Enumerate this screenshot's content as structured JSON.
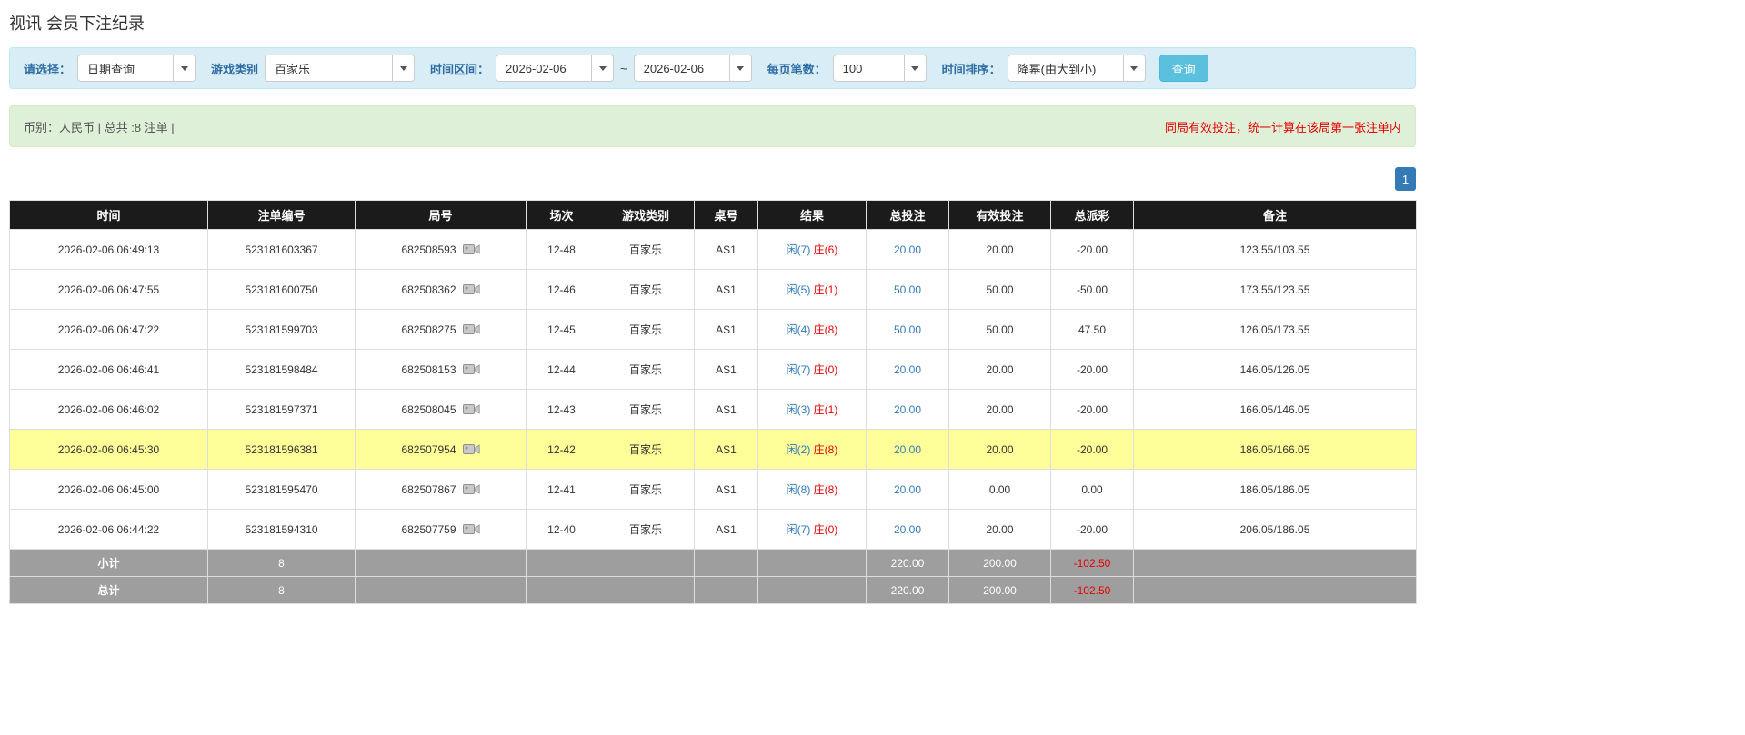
{
  "page_title": "视讯 会员下注纪录",
  "filters": {
    "select_label": "请选择：",
    "select_value": "日期查询",
    "game_type_label": "游戏类别",
    "game_type_value": "百家乐",
    "time_range_label": "时间区间：",
    "date_from": "2026-02-06",
    "tilde": "~",
    "date_to": "2026-02-06",
    "page_size_label": "每页笔数：",
    "page_size_value": "100",
    "sort_label": "时间排序：",
    "sort_value": "降幂(由大到小)",
    "search_button": "查询"
  },
  "summary_bar": {
    "left_text": "币别：人民币 | 总共 :8 注单 |",
    "right_text": "同局有效投注，统一计算在该局第一张注单内"
  },
  "pagination": {
    "current": "1"
  },
  "colors": {
    "accent_blue": "#337ab7",
    "result_player_blue": "#337ab7",
    "result_banker_red": "#e60000",
    "negative_red": "#e60000",
    "highlight_yellow": "#ffff99",
    "header_black": "#1b1b1b",
    "summary_gray": "#9e9e9e"
  },
  "table": {
    "headers": [
      "时间",
      "注单编号",
      "局号",
      "场次",
      "游戏类别",
      "桌号",
      "结果",
      "总投注",
      "有效投注",
      "总派彩",
      "备注"
    ],
    "rows": [
      {
        "time": "2026-02-06 06:49:13",
        "bet_id": "523181603367",
        "round_id": "682508593",
        "session": "12-48",
        "game": "百家乐",
        "table_no": "AS1",
        "result_player": "闲(7)",
        "result_banker": "庄(6)",
        "total_bet": "20.00",
        "valid_bet": "20.00",
        "payout": "-20.00",
        "remark": "123.55/103.55",
        "highlighted": false
      },
      {
        "time": "2026-02-06 06:47:55",
        "bet_id": "523181600750",
        "round_id": "682508362",
        "session": "12-46",
        "game": "百家乐",
        "table_no": "AS1",
        "result_player": "闲(5)",
        "result_banker": "庄(1)",
        "total_bet": "50.00",
        "valid_bet": "50.00",
        "payout": "-50.00",
        "remark": "173.55/123.55",
        "highlighted": false
      },
      {
        "time": "2026-02-06 06:47:22",
        "bet_id": "523181599703",
        "round_id": "682508275",
        "session": "12-45",
        "game": "百家乐",
        "table_no": "AS1",
        "result_player": "闲(4)",
        "result_banker": "庄(8)",
        "total_bet": "50.00",
        "valid_bet": "50.00",
        "payout": "47.50",
        "remark": "126.05/173.55",
        "highlighted": false
      },
      {
        "time": "2026-02-06 06:46:41",
        "bet_id": "523181598484",
        "round_id": "682508153",
        "session": "12-44",
        "game": "百家乐",
        "table_no": "AS1",
        "result_player": "闲(7)",
        "result_banker": "庄(0)",
        "total_bet": "20.00",
        "valid_bet": "20.00",
        "payout": "-20.00",
        "remark": "146.05/126.05",
        "highlighted": false
      },
      {
        "time": "2026-02-06 06:46:02",
        "bet_id": "523181597371",
        "round_id": "682508045",
        "session": "12-43",
        "game": "百家乐",
        "table_no": "AS1",
        "result_player": "闲(3)",
        "result_banker": "庄(1)",
        "total_bet": "20.00",
        "valid_bet": "20.00",
        "payout": "-20.00",
        "remark": "166.05/146.05",
        "highlighted": false
      },
      {
        "time": "2026-02-06 06:45:30",
        "bet_id": "523181596381",
        "round_id": "682507954",
        "session": "12-42",
        "game": "百家乐",
        "table_no": "AS1",
        "result_player": "闲(2)",
        "result_banker": "庄(8)",
        "total_bet": "20.00",
        "valid_bet": "20.00",
        "payout": "-20.00",
        "remark": "186.05/166.05",
        "highlighted": true
      },
      {
        "time": "2026-02-06 06:45:00",
        "bet_id": "523181595470",
        "round_id": "682507867",
        "session": "12-41",
        "game": "百家乐",
        "table_no": "AS1",
        "result_player": "闲(8)",
        "result_banker": "庄(8)",
        "total_bet": "20.00",
        "valid_bet": "0.00",
        "payout": "0.00",
        "remark": "186.05/186.05",
        "highlighted": false
      },
      {
        "time": "2026-02-06 06:44:22",
        "bet_id": "523181594310",
        "round_id": "682507759",
        "session": "12-40",
        "game": "百家乐",
        "table_no": "AS1",
        "result_player": "闲(7)",
        "result_banker": "庄(0)",
        "total_bet": "20.00",
        "valid_bet": "20.00",
        "payout": "-20.00",
        "remark": "206.05/186.05",
        "highlighted": false
      }
    ],
    "subtotal": {
      "label": "小计",
      "count": "8",
      "total_bet": "220.00",
      "valid_bet": "200.00",
      "payout": "-102.50"
    },
    "total": {
      "label": "总计",
      "count": "8",
      "total_bet": "220.00",
      "valid_bet": "200.00",
      "payout": "-102.50"
    }
  }
}
